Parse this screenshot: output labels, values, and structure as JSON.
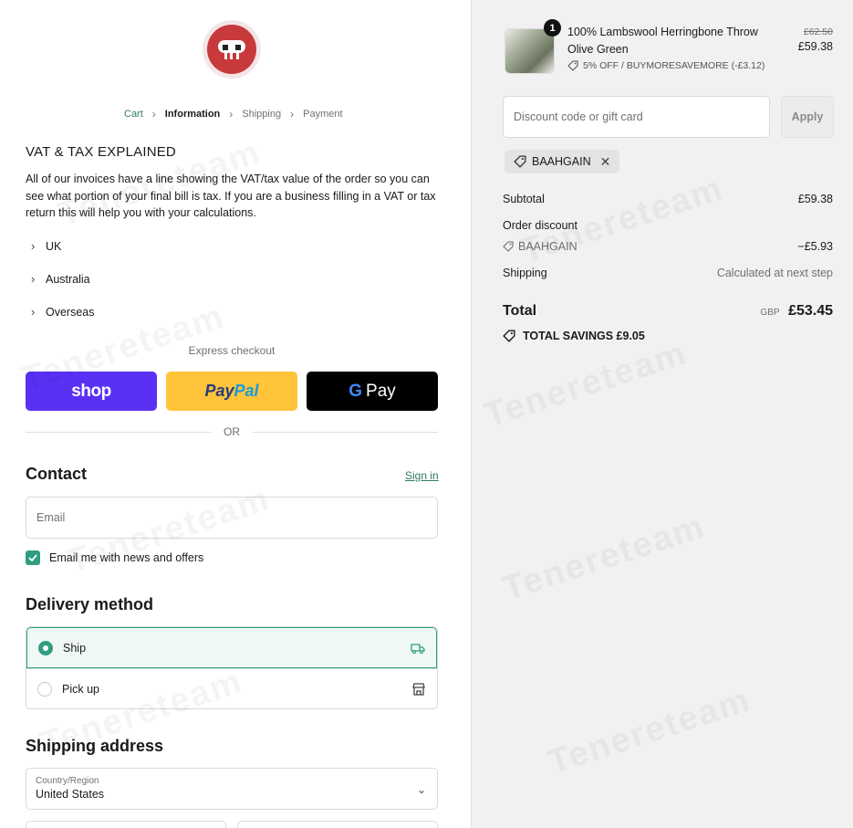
{
  "breadcrumb": {
    "cart": "Cart",
    "information": "Information",
    "shipping": "Shipping",
    "payment": "Payment"
  },
  "vat": {
    "title": "VAT & TAX EXPLAINED",
    "text": "All of our invoices have a line showing the VAT/tax value of the order so you can see what portion of your final bill is tax. If you are a business filling in a VAT or tax return this will help you with your calculations.",
    "sections": [
      "UK",
      "Australia",
      "Overseas"
    ]
  },
  "express": {
    "label": "Express checkout",
    "shop": "shop",
    "paypal_a": "Pay",
    "paypal_b": "Pal",
    "gpay_g": "G",
    "gpay": "Pay",
    "or": "OR"
  },
  "contact": {
    "title": "Contact",
    "signin": "Sign in",
    "email_placeholder": "Email",
    "newsletter": "Email me with news and offers",
    "newsletter_checked": true
  },
  "delivery": {
    "title": "Delivery method",
    "ship": "Ship",
    "pickup": "Pick up",
    "selected": "Ship"
  },
  "shipping_address": {
    "title": "Shipping address",
    "country_label": "Country/Region",
    "country_value": "United States"
  },
  "summary": {
    "quantity": "1",
    "product_name": "100% Lambswool Herringbone Throw Olive Green",
    "product_discount": "5% OFF / BUYMORESAVEMORE (-£3.12)",
    "old_price": "£62.50",
    "price": "£59.38",
    "discount_placeholder": "Discount code or gift card",
    "apply": "Apply",
    "code": "BAAHGAIN",
    "subtotal_label": "Subtotal",
    "subtotal": "£59.38",
    "order_discount_label": "Order discount",
    "order_discount_code": "BAAHGAIN",
    "order_discount": "−£5.93",
    "shipping_label": "Shipping",
    "shipping_value": "Calculated at next step",
    "total_label": "Total",
    "currency": "GBP",
    "total": "£53.45",
    "savings": "TOTAL SAVINGS  £9.05"
  },
  "colors": {
    "accent": "#2f9e80",
    "link": "#2f7a66",
    "shop_pay": "#5a31f4",
    "paypal": "#ffc439",
    "gpay": "#000000",
    "logo": "#c8393c"
  }
}
